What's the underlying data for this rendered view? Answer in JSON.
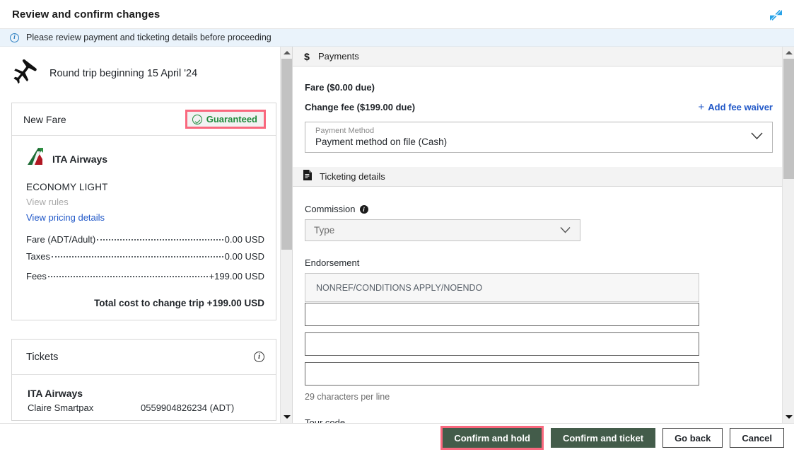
{
  "titlebar": {
    "title": "Review and confirm changes",
    "collapse_icon": "collapse-diagonal-arrows-icon",
    "collapse_color": "#29a3e8"
  },
  "infobar": {
    "icon": "info-circle-icon",
    "message": "Please review payment and ticketing details before proceeding"
  },
  "left": {
    "trip": {
      "icon": "airplane-icon",
      "label": "Round trip beginning 15 April '24"
    },
    "fare_card": {
      "title": "New Fare",
      "badge": {
        "icon": "check-circle-icon",
        "label": "Guaranteed",
        "text_color": "#1f8a3c",
        "highlight_color": "#f9687e"
      },
      "airline": {
        "logo": "ita-airways-logo-icon",
        "name": "ITA Airways"
      },
      "fare_class": "ECONOMY LIGHT",
      "view_rules": "View rules",
      "view_pricing_details": "View pricing details",
      "price_lines": [
        {
          "label": "Fare (ADT/Adult)",
          "value": "0.00 USD"
        },
        {
          "label": "Taxes",
          "value": "0.00 USD"
        },
        {
          "label": "Fees",
          "value": "+199.00 USD"
        }
      ],
      "total": "Total cost to change trip +199.00 USD"
    },
    "tickets_card": {
      "title": "Tickets",
      "info_icon": "info-circle-icon",
      "airline": "ITA Airways",
      "rows": [
        {
          "passenger": "Claire Smartpax",
          "number": "0559904826234 (ADT)"
        }
      ]
    }
  },
  "right": {
    "payments": {
      "icon": "dollar-sign-icon",
      "title": "Payments",
      "fare_line": "Fare ($0.00 due)",
      "change_fee_line": "Change fee ($199.00 due)",
      "add_fee_waiver": "Add fee waiver",
      "add_fee_waiver_plus": "+",
      "payment_method": {
        "label": "Payment Method",
        "value": "Payment method on file (Cash)",
        "chevron_icon": "chevron-down-icon"
      }
    },
    "ticketing": {
      "icon": "document-icon",
      "title": "Ticketing details",
      "commission_label": "Commission",
      "commission_info_icon": "info-dot-icon",
      "commission_type_placeholder": "Type",
      "commission_chevron_icon": "chevron-down-icon",
      "endorsement_label": "Endorsement",
      "endorsement_lines": [
        "NONREF/CONDITIONS APPLY/NOENDO",
        "",
        "",
        ""
      ],
      "hint": "29 characters per line",
      "tour_code_label": "Tour code"
    }
  },
  "footer": {
    "buttons": [
      {
        "label": "Confirm and hold",
        "style": "primary",
        "highlighted": true
      },
      {
        "label": "Confirm and ticket",
        "style": "primary",
        "highlighted": false
      },
      {
        "label": "Go back",
        "style": "secondary",
        "highlighted": false
      },
      {
        "label": "Cancel",
        "style": "secondary",
        "highlighted": false
      }
    ],
    "primary_color": "#435c4a",
    "highlight_color": "#f9687e"
  },
  "scrollbars": {
    "left": {
      "up_icon": "triangle-up-icon",
      "down_icon": "triangle-down-icon"
    },
    "right": {
      "up_icon": "triangle-up-icon",
      "down_icon": "triangle-down-icon"
    }
  }
}
